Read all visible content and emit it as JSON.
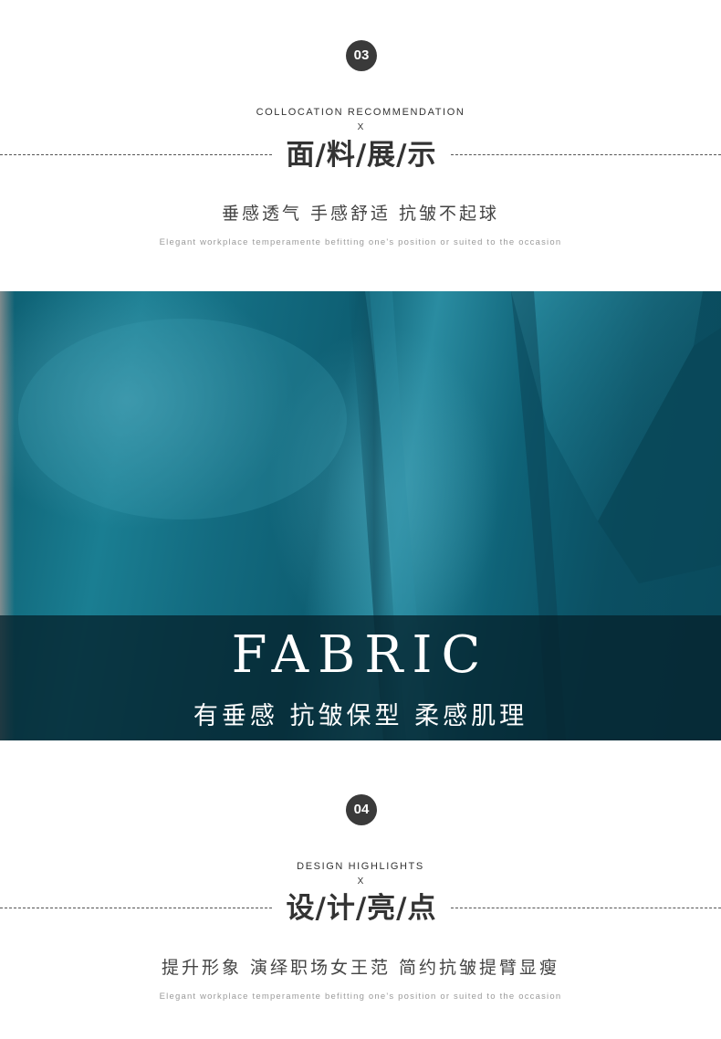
{
  "section_fabric": {
    "number": "03",
    "eyebrow": "COLLOCATION RECOMMENDATION",
    "cross": "X",
    "title": "面/料/展/示",
    "subtitle": "垂感透气 手感舒适 抗皱不起球",
    "tagline": "Elegant workplace temperamente befitting one's position or suited to the occasion"
  },
  "banner": {
    "heading": "FABRIC",
    "caption": "有垂感 抗皱保型 柔感肌理",
    "fabric_color": "#136b80"
  },
  "section_design": {
    "number": "04",
    "eyebrow": "DESIGN HIGHLIGHTS",
    "cross": "X",
    "title": "设/计/亮/点",
    "subtitle": "提升形象 演绎职场女王范 简约抗皱提臂显瘦",
    "tagline": "Elegant workplace temperamente befitting one's position or suited to the occasion"
  }
}
